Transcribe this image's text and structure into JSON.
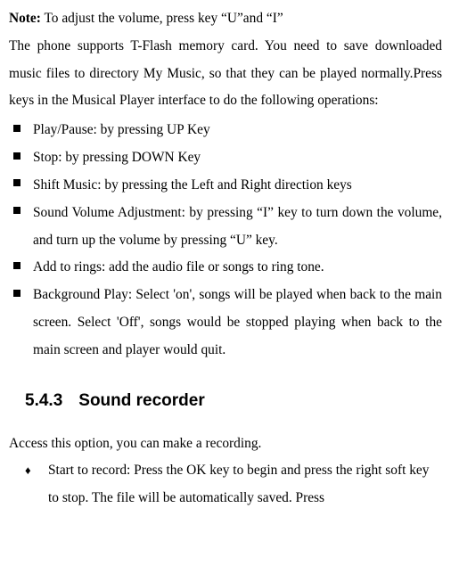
{
  "note": {
    "label": "Note:",
    "text": " To adjust the volume, press key “U”and “I”"
  },
  "intro": "The phone supports T-Flash memory card. You need to save downloaded music files to directory My Music, so that they can be played normally.Press keys in the Musical Player interface to do the following operations:",
  "bullets": [
    "Play/Pause: by pressing UP Key",
    "Stop: by pressing DOWN Key",
    "Shift Music: by pressing the Left and Right direction keys",
    "Sound Volume Adjustment: by pressing “I” key to turn down the volume, and turn up the volume by pressing “U” key.",
    "Add to rings: add the audio file or songs to ring tone.",
    "Background Play: Select 'on', songs will be played when back to the main screen. Select 'Off', songs would be stopped playing when back to the main screen and player would quit."
  ],
  "section": {
    "number": "5.4.3",
    "title": "Sound recorder"
  },
  "record_intro": "Access this option, you can make a recording.",
  "record_items": [
    "Start to record: Press the OK key to begin and press the right soft key to stop. The file will be automatically saved. Press"
  ]
}
